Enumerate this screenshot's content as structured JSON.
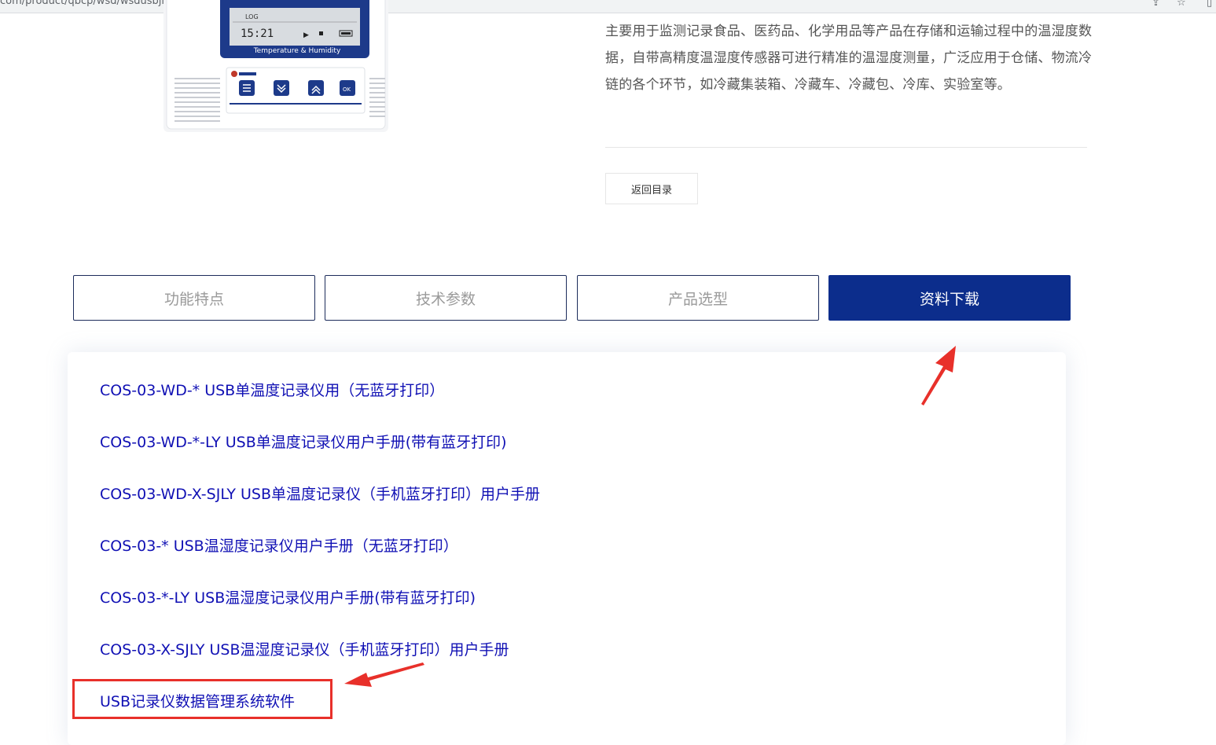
{
  "browser": {
    "url": "com/product/qbcp/wsd/wsdusbjly/106.html",
    "icons": [
      "share-icon",
      "star-icon",
      "panel-icon"
    ]
  },
  "product": {
    "device_screen_text": {
      "log": "LOG",
      "reading": "15:21",
      "label": "Temperature & Humidity"
    },
    "description": "主要用于监测记录食品、医药品、化学用品等产品在存储和运输过程中的温湿度数据，自带高精度温湿度传感器可进行精准的温湿度测量，广泛应用于仓储、物流冷链的各个环节，如冷藏集装箱、冷藏车、冷藏包、冷库、实验室等。",
    "back_button": "返回目录"
  },
  "tabs": [
    {
      "label": "功能特点",
      "active": false
    },
    {
      "label": "技术参数",
      "active": false
    },
    {
      "label": "产品选型",
      "active": false
    },
    {
      "label": "资料下载",
      "active": true
    }
  ],
  "downloads": [
    "COS-03-WD-* USB单温度记录仪用（无蓝牙打印）",
    "COS-03-WD-*-LY USB单温度记录仪用户手册(带有蓝牙打印)",
    "COS-03-WD-X-SJLY USB单温度记录仪（手机蓝牙打印）用户手册",
    "COS-03-* USB温湿度记录仪用户手册（无蓝牙打印）",
    "COS-03-*-LY USB温湿度记录仪用户手册(带有蓝牙打印)",
    "COS-03-X-SJLY USB温湿度记录仪（手机蓝牙打印）用户手册",
    "USB记录仪数据管理系统软件"
  ],
  "colors": {
    "tab_active": "#0c2d8c",
    "link": "#1010b4",
    "annotation": "#e8302a"
  }
}
